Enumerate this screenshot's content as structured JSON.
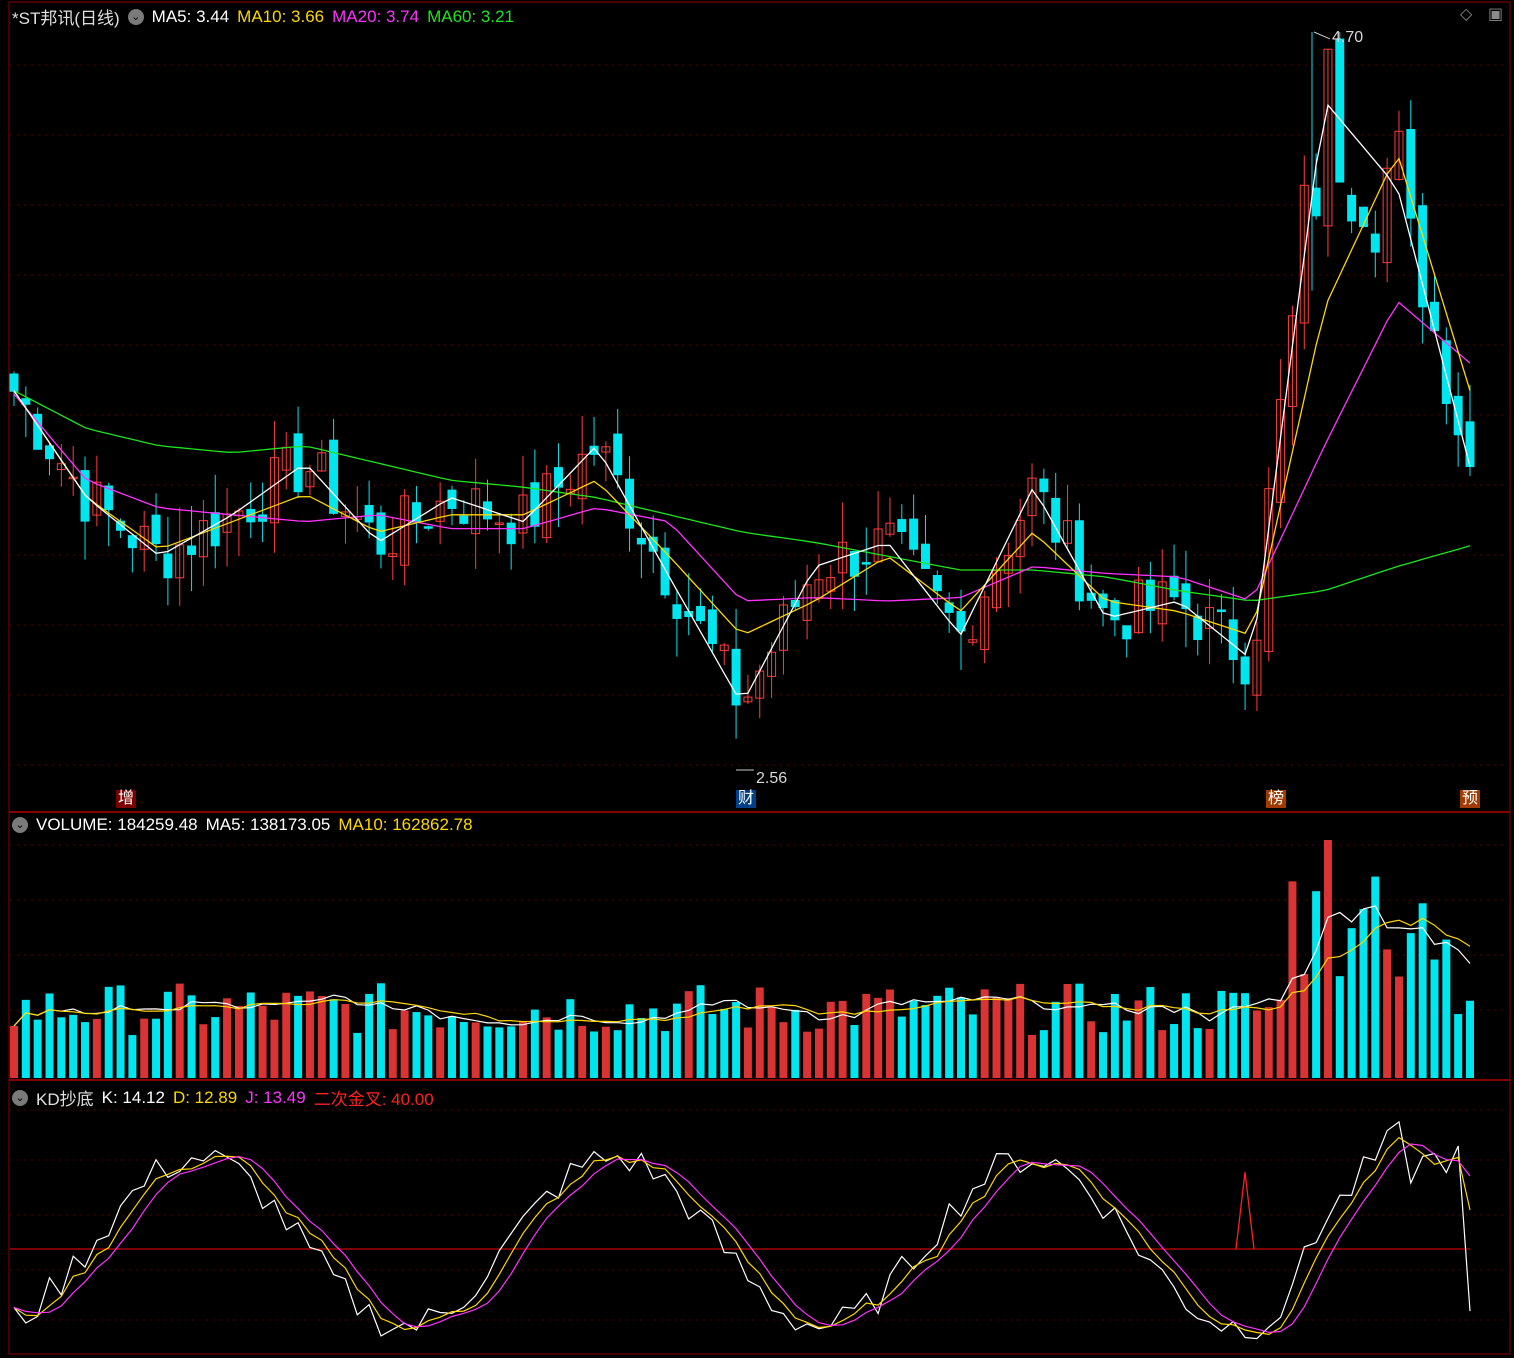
{
  "colors": {
    "up": "#ff3c3c",
    "down": "#00e5ee",
    "ma5": "#ffffff",
    "ma10": "#ffd700",
    "ma20": "#ff32ff",
    "ma60": "#1ee61e",
    "red_line": "#c80000",
    "grid": "#5a0000"
  },
  "main": {
    "title": "*ST邦讯(日线)",
    "ma5_label": "MA5: 3.44",
    "ma10_label": "MA10: 3.66",
    "ma20_label": "MA20: 3.74",
    "ma60_label": "MA60: 3.21",
    "high_label": "4.70",
    "low_label": "2.56",
    "tags": [
      "增",
      "财",
      "榜",
      "预"
    ]
  },
  "volume": {
    "label": "VOLUME: 184259.48",
    "ma5_label": "MA5: 138173.05",
    "ma10_label": "MA10: 162862.78"
  },
  "kd": {
    "name": "KD抄底",
    "k_label": "K: 14.12",
    "d_label": "D: 12.89",
    "j_label": "J: 13.49",
    "cross_label": "二次金叉: 40.00"
  },
  "icons": {
    "indicator_toggle": "chevron-down-circle-icon",
    "diamond": "diamond-icon",
    "window": "window-icon"
  },
  "chart_data": {
    "type": "candlestick",
    "price_axis_range": [
      2.5,
      4.8
    ],
    "ma_anchor_points": {
      "ma5": [
        3.66,
        3.35,
        3.18,
        3.3,
        3.45,
        3.22,
        3.35,
        3.28,
        3.5,
        3.12,
        2.75,
        3.15,
        3.22,
        2.95,
        3.38,
        3.0,
        3.05,
        2.88,
        4.5,
        4.25,
        3.44
      ],
      "ma10": [
        3.66,
        3.35,
        3.2,
        3.28,
        3.36,
        3.25,
        3.3,
        3.3,
        3.4,
        3.18,
        2.95,
        3.05,
        3.18,
        3.02,
        3.25,
        3.05,
        3.02,
        2.95,
        3.9,
        4.35,
        3.66
      ],
      "ma20": [
        3.65,
        3.4,
        3.32,
        3.3,
        3.28,
        3.3,
        3.26,
        3.26,
        3.32,
        3.28,
        3.05,
        3.06,
        3.05,
        3.06,
        3.15,
        3.13,
        3.12,
        3.05,
        3.5,
        3.92,
        3.74
      ],
      "ma60": [
        3.66,
        3.55,
        3.5,
        3.48,
        3.5,
        3.45,
        3.4,
        3.38,
        3.35,
        3.3,
        3.25,
        3.22,
        3.18,
        3.14,
        3.14,
        3.12,
        3.08,
        3.05,
        3.08,
        3.15,
        3.21
      ]
    },
    "volume_latest": 184259.48,
    "kd_latest": {
      "K": 14.12,
      "D": 12.89,
      "J": 13.49,
      "cross": 40.0
    }
  }
}
